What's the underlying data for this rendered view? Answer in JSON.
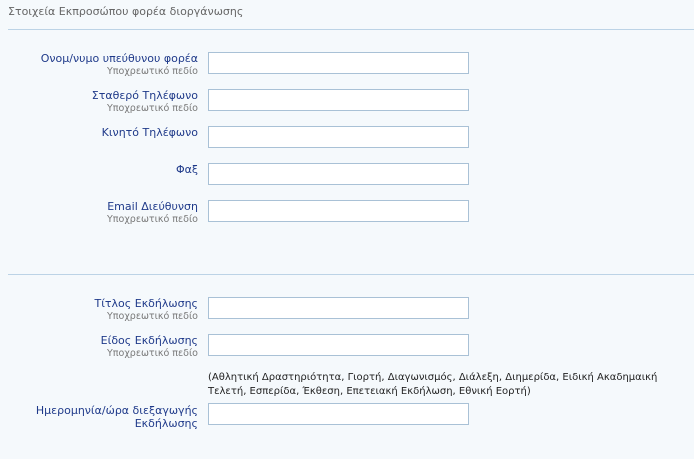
{
  "section_title": "Στοιχεία Εκπροσώπου φορέα διοργάνωσης",
  "required_note": "Υποχρεωτικό πεδίο",
  "fields": {
    "rep_name": {
      "label": "Ονομ/νυμο υπεύθυνου φορέα",
      "value": "",
      "required": true
    },
    "landline": {
      "label": "Σταθερό Τηλέφωνο",
      "value": "",
      "required": true
    },
    "mobile": {
      "label": "Κινητό Τηλέφωνο",
      "value": "",
      "required": false
    },
    "fax": {
      "label": "Φαξ",
      "value": "",
      "required": false
    },
    "email": {
      "label": "Email Διεύθυνση",
      "value": "",
      "required": true
    },
    "event_title": {
      "label": "Τίτλος Εκδήλωσης",
      "value": "",
      "required": true
    },
    "event_type": {
      "label": "Είδος Εκδήλωσης",
      "value": "",
      "required": true
    },
    "event_datetime": {
      "label": "Ημερομηνία/ώρα διεξαγωγής Εκδήλωσης",
      "value": "",
      "required": false
    }
  },
  "event_type_hint": "(Αθλητική Δραστηριότητα, Γιορτή, Διαγωνισμός, Διάλεξη, Διημερίδα, Ειδική Ακαδημαική Τελετή, Εσπερίδα, Έκθεση, Επετειακή Εκδήλωση, Εθνική Εορτή)"
}
